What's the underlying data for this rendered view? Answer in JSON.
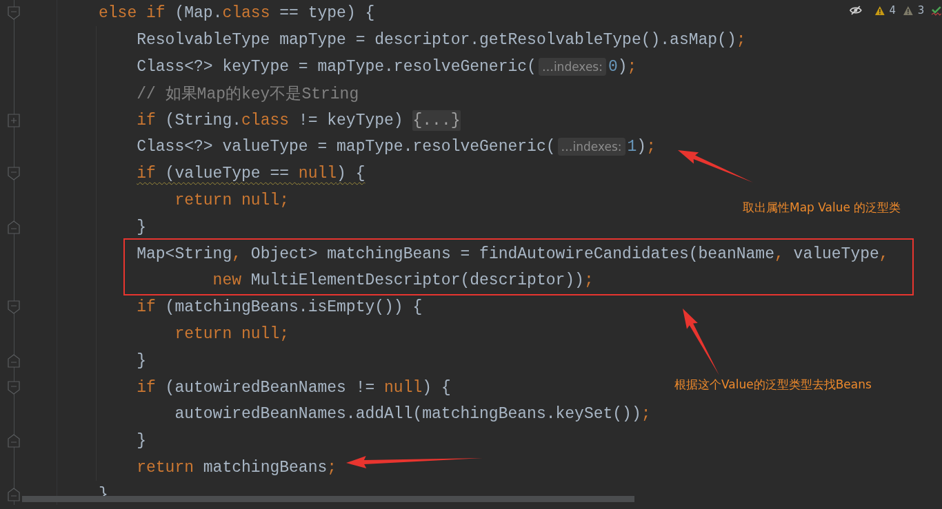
{
  "inspections": [
    {
      "kind": "warning",
      "count": "4"
    },
    {
      "kind": "weak-warning",
      "count": "3"
    },
    {
      "kind": "passed"
    }
  ],
  "lines": [
    {
      "fold_start": true,
      "tokens": [
        {
          "kind": "kw",
          "t": "else if"
        },
        {
          "kind": "p",
          "t": " (Map."
        },
        {
          "kind": "kw",
          "t": "class"
        },
        {
          "kind": "p",
          "t": " == type) {"
        }
      ],
      "children": [
        {
          "tokens": [
            {
              "kind": "p",
              "t": "ResolvableType mapType = descriptor.getResolvableType().asMap()"
            },
            {
              "kind": "kw",
              "t": ";"
            }
          ]
        },
        {
          "tokens": [
            {
              "kind": "p",
              "t": "Class<?> keyType = mapType.resolveGeneric("
            },
            {
              "kind": "hint",
              "t": "…indexes:"
            },
            {
              "kind": "num",
              "t": "0"
            },
            {
              "kind": "p",
              "t": ")"
            },
            {
              "kind": "kw",
              "t": ";"
            }
          ]
        },
        {
          "tokens": [
            {
              "kind": "comment",
              "t": "// 如果Map的key不是String"
            }
          ]
        },
        {
          "collapsed": true,
          "tokens": [
            {
              "kind": "kw",
              "t": "if"
            },
            {
              "kind": "p",
              "t": " (String."
            },
            {
              "kind": "kw",
              "t": "class"
            },
            {
              "kind": "p",
              "t": " != keyType) "
            },
            {
              "kind": "folded",
              "t": "{...}"
            }
          ]
        },
        {
          "tokens": [
            {
              "kind": "p",
              "t": "Class<?> valueType = mapType.resolveGeneric("
            },
            {
              "kind": "hint",
              "t": "…indexes:"
            },
            {
              "kind": "num",
              "t": "1"
            },
            {
              "kind": "p",
              "t": ")"
            },
            {
              "kind": "kw",
              "t": ";"
            }
          ]
        },
        {
          "fold_start": true,
          "warning": true,
          "tokens": [
            {
              "kind": "kw",
              "t": "if"
            },
            {
              "kind": "p",
              "t": " (valueType == "
            },
            {
              "kind": "kw",
              "t": "null"
            },
            {
              "kind": "p",
              "t": ") {"
            }
          ],
          "children": [
            {
              "tokens": [
                {
                  "kind": "kw",
                  "t": "return null;"
                }
              ]
            }
          ]
        },
        {
          "fold_end": true,
          "tokens": [
            {
              "kind": "p",
              "t": "}"
            }
          ]
        },
        {
          "boxed": true,
          "tokens": [
            {
              "kind": "p",
              "t": "Map<String"
            },
            {
              "kind": "kw",
              "t": ","
            },
            {
              "kind": "p",
              "t": " Object> matchingBeans = findAutowireCandidates(beanName"
            },
            {
              "kind": "kw",
              "t": ","
            },
            {
              "kind": "p",
              "t": " valueType"
            },
            {
              "kind": "kw",
              "t": ","
            }
          ]
        },
        {
          "boxed": true,
          "wrapped": true,
          "tokens": [
            {
              "kind": "kw",
              "t": "new"
            },
            {
              "kind": "p",
              "t": " MultiElementDescriptor(descriptor))"
            },
            {
              "kind": "kw",
              "t": ";"
            }
          ]
        },
        {
          "fold_start": true,
          "tokens": [
            {
              "kind": "kw",
              "t": "if"
            },
            {
              "kind": "p",
              "t": " (matchingBeans.isEmpty()) {"
            }
          ],
          "children": [
            {
              "tokens": [
                {
                  "kind": "kw",
                  "t": "return null;"
                }
              ]
            }
          ]
        },
        {
          "fold_end": true,
          "tokens": [
            {
              "kind": "p",
              "t": "}"
            }
          ]
        },
        {
          "fold_start": true,
          "tokens": [
            {
              "kind": "kw",
              "t": "if"
            },
            {
              "kind": "p",
              "t": " (autowiredBeanNames != "
            },
            {
              "kind": "kw",
              "t": "null"
            },
            {
              "kind": "p",
              "t": ") {"
            }
          ],
          "children": [
            {
              "tokens": [
                {
                  "kind": "p",
                  "t": "autowiredBeanNames.addAll(matchingBeans.keySet())"
                },
                {
                  "kind": "kw",
                  "t": ";"
                }
              ]
            }
          ]
        },
        {
          "fold_end": true,
          "tokens": [
            {
              "kind": "p",
              "t": "}"
            }
          ]
        },
        {
          "tokens": [
            {
              "kind": "kw",
              "t": "return"
            },
            {
              "kind": "p",
              "t": " matchingBeans"
            },
            {
              "kind": "kw",
              "t": ";"
            }
          ]
        }
      ]
    },
    {
      "fold_end": true,
      "tokens": [
        {
          "kind": "p",
          "t": "}"
        }
      ]
    }
  ],
  "annotations": [
    {
      "text": "取出属性Map Value 的泛型类"
    },
    {
      "text": "根据这个Value的泛型类型去找Beans"
    }
  ]
}
